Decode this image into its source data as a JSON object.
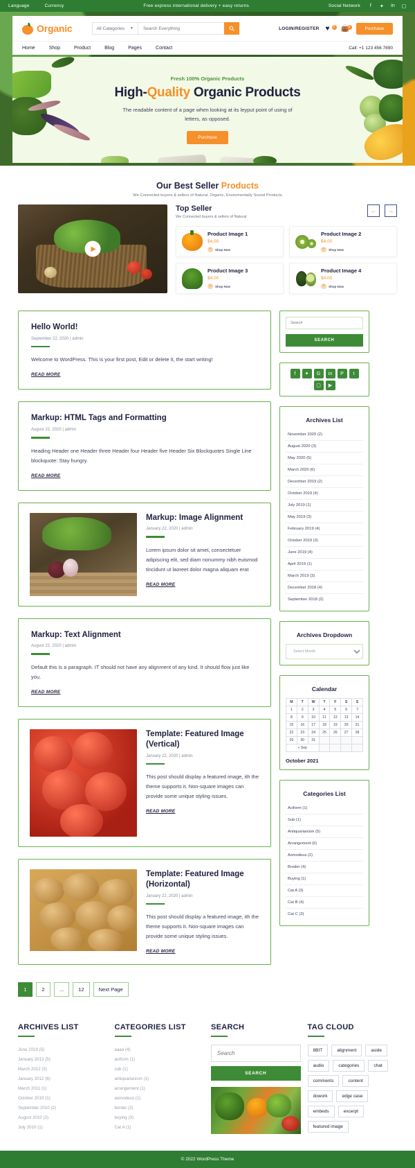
{
  "topbar": {
    "language": "Language",
    "currency": "Currency",
    "promo": "Free express international delivery + easy returns",
    "social_label": "Social Network",
    "social_icons": [
      "facebook-icon",
      "twitter-icon",
      "linkedin-icon",
      "instagram-icon"
    ]
  },
  "header": {
    "logo_text": "Organic",
    "category_select": "All Categories",
    "search_placeholder": "Search Everything",
    "search_icon": "search-icon",
    "login_label": "LOGIN/REGISTER",
    "wishlist_count": "0",
    "cart_count": "0",
    "purchase_label": "Purchase",
    "nav": [
      "Home",
      "Shop",
      "Product",
      "Blog",
      "Pages",
      "Contact"
    ],
    "call": "Call: +1 123 456 7890"
  },
  "hero": {
    "eyebrow": "Fresh 100% Organic Products",
    "title_a": "High-",
    "title_hl": "Quality",
    "title_b": " Organic Products",
    "subtitle": "The readable content of a page when looking at its leyput point of using of letters, as opposed.",
    "cta": "Purchase"
  },
  "bestseller": {
    "title_a": "Our Best Seller ",
    "title_hl": "Products",
    "subtitle": "We Connected buyers & sellers of Natural, Organic, Enviormentally Sound Products",
    "top_seller_title": "Top Seller",
    "top_seller_sub": "We Connected buyers & sellers of Natural",
    "prev_icon": "arrow-left-icon",
    "next_icon": "arrow-right-icon",
    "shop_now": "Shop Now",
    "products": [
      {
        "name": "Product Image 1",
        "price": "$4.00",
        "thumb": "bell-pepper-icon"
      },
      {
        "name": "Product Image 2",
        "price": "$4.00",
        "thumb": "kiwi-icon"
      },
      {
        "name": "Product Image 3",
        "price": "$4.00",
        "thumb": "broccoli-icon"
      },
      {
        "name": "Product Image 4",
        "price": "$4.00",
        "thumb": "avocado-icon"
      }
    ]
  },
  "posts": [
    {
      "title": "Hello World!",
      "meta": "September 22, 2020 | admin",
      "excerpt": "Welcome to WordPress. This is your first post, Edit or delete it, the start writing!",
      "read_more": "READ MORE",
      "has_image": false
    },
    {
      "title": "Markup: HTML Tags and Formatting",
      "meta": "August 22, 2020 | admin",
      "excerpt": "Heading Header one Header three Header four Header five Header Six Blockquotes Single Line blockquote: Stay hungry.",
      "read_more": "READ MORE",
      "has_image": false
    },
    {
      "title": "Markup: Image Alignment",
      "meta": "January 22, 2020 | admin",
      "excerpt": "Lorem ipsum dolor sit amet, consectetuer adipiscing elit, sed diam nonummy nibh euismod tincidunt ut laoreet dolor magna aliquam erat",
      "read_more": "READ MORE",
      "has_image": true,
      "image": "vegetables-cutting-board-photo"
    },
    {
      "title": "Markup: Text Alignment",
      "meta": "August 22, 2020 | admin",
      "excerpt": "Default this is a paragraph. IT should not have any alignment of any kind. It should flow just like you.",
      "read_more": "READ MORE",
      "has_image": false
    },
    {
      "title": "Template: Featured Image (Vertical)",
      "meta": "January 22, 2020 | admin",
      "excerpt": "This post should display a featured image, ith the theme supports it. Non-square images can provide some unique styling issues.",
      "read_more": "READ MORE",
      "has_image": true,
      "image": "tomatoes-photo"
    },
    {
      "title": "Template: Featured Image (Horizontal)",
      "meta": "January 22, 2020 | admin",
      "excerpt": "This post should display a featured image, ith the theme supports it. Non-square images can provide some unique styling issues.",
      "read_more": "READ MORE",
      "has_image": true,
      "image": "potatoes-photo"
    }
  ],
  "sidebar": {
    "search_placeholder": "Search",
    "search_button": "SEARCH",
    "social_icons": [
      "facebook-icon",
      "twitter-icon",
      "google-plus-icon",
      "linkedin-icon",
      "pinterest-icon",
      "tumblr-icon",
      "instagram-icon",
      "youtube-icon"
    ],
    "archives_title": "Archives List",
    "archives": [
      "November 2020 (2)",
      "August 2020 (3)",
      "May 2020 (5)",
      "March 2020 (6)",
      "December 2019 (2)",
      "October 2019 (4)",
      "July 2019 (1)",
      "May 2019 (3)",
      "February 2019 (4)",
      "October 2019 (3)",
      "June 2019 (4)",
      "April 2019 (1)",
      "March 2019 (3)",
      "December 2018 (4)",
      "September 2018 (2)"
    ],
    "dropdown_title": "Archives Dropdown",
    "dropdown_value": "Select Month",
    "calendar_title": "Calendar",
    "calendar_days": [
      "M",
      "T",
      "W",
      "T",
      "F",
      "S",
      "S"
    ],
    "calendar_weeks": [
      [
        "1",
        "2",
        "3",
        "4",
        "5",
        "6",
        "7"
      ],
      [
        "8",
        "9",
        "10",
        "11",
        "12",
        "13",
        "14"
      ],
      [
        "15",
        "16",
        "17",
        "18",
        "19",
        "20",
        "21"
      ],
      [
        "22",
        "23",
        "24",
        "25",
        "26",
        "27",
        "28"
      ],
      [
        "29",
        "30",
        "31",
        "",
        "",
        "",
        ""
      ]
    ],
    "calendar_prev": "« Sep",
    "calendar_month": "October 2021",
    "categories_title": "Categories List",
    "categories": [
      "Aciform (1)",
      "Sub (1)",
      "Antiquarianism (5)",
      "Arrangement (6)",
      "Asmodeus (2)",
      "Broder (4)",
      "Buying (1)",
      "Cat A (3)",
      "Cat B (4)",
      "Cat C (3)"
    ]
  },
  "pagination": [
    "1",
    "2",
    "...",
    "12",
    "Next Page"
  ],
  "footer_widgets": {
    "archives_title": "ARCHIVES LIST",
    "archives": [
      "June 2019 (5)",
      "January  2013 (5)",
      "March 2012 (5)",
      "January  2012 (6)",
      "March  2011 (1)",
      "October 2010 (1)",
      "September 2010 (2)",
      "August 2010 (3)",
      "July 2010 (1)"
    ],
    "categories_title": "CATEGORIES LIST",
    "categories": [
      "aaaa (4)",
      "aciform (1)",
      "sub (1)",
      "antiquarianism (1)",
      "arrangement (1)",
      "asmodeus (1)",
      "border (2)",
      "buying (3)",
      "Cat A (1)"
    ],
    "search_title": "SEARCH",
    "search_placeholder": "Search",
    "search_button": "SEARCH",
    "search_image": "vegetables-photo",
    "tag_title": "TAG CLOUD",
    "tags": [
      "8BIT",
      "alignment",
      "aside",
      "audio",
      "categories",
      "chat",
      "comments",
      "content",
      "dowork",
      "edge case",
      "embeds",
      "excerpt",
      "featured image"
    ]
  },
  "footer": {
    "copyright": "© 2022  WordPress Theme"
  },
  "colors": {
    "green": "#2e7d32",
    "orange": "#f5902a",
    "navy": "#20223f",
    "border_green": "#6ab04c"
  }
}
